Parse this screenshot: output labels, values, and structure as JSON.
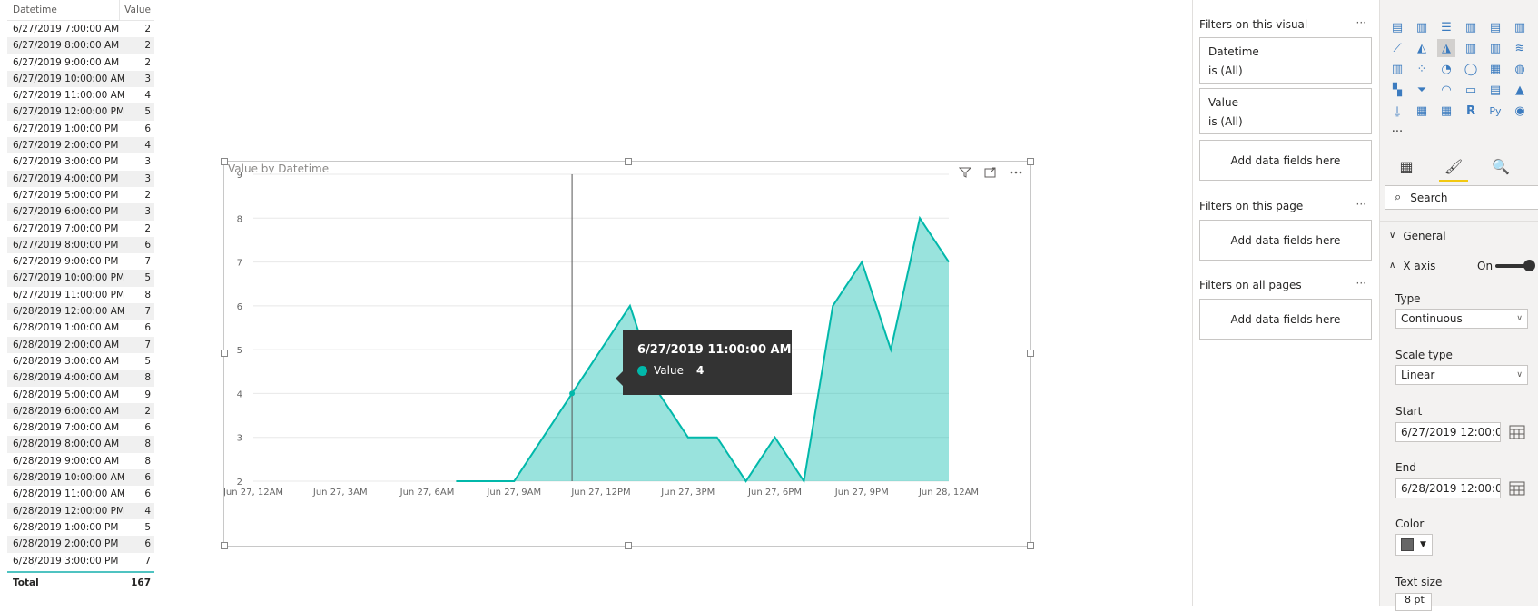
{
  "table": {
    "headers": [
      "Datetime",
      "Value"
    ],
    "rows": [
      [
        "6/27/2019 7:00:00 AM",
        "2"
      ],
      [
        "6/27/2019 8:00:00 AM",
        "2"
      ],
      [
        "6/27/2019 9:00:00 AM",
        "2"
      ],
      [
        "6/27/2019 10:00:00 AM",
        "3"
      ],
      [
        "6/27/2019 11:00:00 AM",
        "4"
      ],
      [
        "6/27/2019 12:00:00 PM",
        "5"
      ],
      [
        "6/27/2019 1:00:00 PM",
        "6"
      ],
      [
        "6/27/2019 2:00:00 PM",
        "4"
      ],
      [
        "6/27/2019 3:00:00 PM",
        "3"
      ],
      [
        "6/27/2019 4:00:00 PM",
        "3"
      ],
      [
        "6/27/2019 5:00:00 PM",
        "2"
      ],
      [
        "6/27/2019 6:00:00 PM",
        "3"
      ],
      [
        "6/27/2019 7:00:00 PM",
        "2"
      ],
      [
        "6/27/2019 8:00:00 PM",
        "6"
      ],
      [
        "6/27/2019 9:00:00 PM",
        "7"
      ],
      [
        "6/27/2019 10:00:00 PM",
        "5"
      ],
      [
        "6/27/2019 11:00:00 PM",
        "8"
      ],
      [
        "6/28/2019 12:00:00 AM",
        "7"
      ],
      [
        "6/28/2019 1:00:00 AM",
        "6"
      ],
      [
        "6/28/2019 2:00:00 AM",
        "7"
      ],
      [
        "6/28/2019 3:00:00 AM",
        "5"
      ],
      [
        "6/28/2019 4:00:00 AM",
        "8"
      ],
      [
        "6/28/2019 5:00:00 AM",
        "9"
      ],
      [
        "6/28/2019 6:00:00 AM",
        "2"
      ],
      [
        "6/28/2019 7:00:00 AM",
        "6"
      ],
      [
        "6/28/2019 8:00:00 AM",
        "8"
      ],
      [
        "6/28/2019 9:00:00 AM",
        "8"
      ],
      [
        "6/28/2019 10:00:00 AM",
        "6"
      ],
      [
        "6/28/2019 11:00:00 AM",
        "6"
      ],
      [
        "6/28/2019 12:00:00 PM",
        "4"
      ],
      [
        "6/28/2019 1:00:00 PM",
        "5"
      ],
      [
        "6/28/2019 2:00:00 PM",
        "6"
      ],
      [
        "6/28/2019 3:00:00 PM",
        "7"
      ]
    ],
    "total_label": "Total",
    "total_value": "167"
  },
  "visual": {
    "title": "Value by Datetime",
    "icons": [
      "filter-icon",
      "focus-mode-icon",
      "more-options-icon"
    ]
  },
  "chart_data": {
    "type": "area",
    "title": "Value by Datetime",
    "x_tick_labels": [
      "Jun 27, 12AM",
      "Jun 27, 3AM",
      "Jun 27, 6AM",
      "Jun 27, 9AM",
      "Jun 27, 12PM",
      "Jun 27, 3PM",
      "Jun 27, 6PM",
      "Jun 27, 9PM",
      "Jun 28, 12AM"
    ],
    "y_tick_labels": [
      "2",
      "3",
      "4",
      "5",
      "6",
      "7",
      "8",
      "9"
    ],
    "ylim": [
      2,
      9
    ],
    "grid": true,
    "color": "#01b8aa",
    "series": [
      {
        "name": "Value",
        "x": [
          "6/27/2019 7:00:00 AM",
          "6/27/2019 8:00:00 AM",
          "6/27/2019 9:00:00 AM",
          "6/27/2019 10:00:00 AM",
          "6/27/2019 11:00:00 AM",
          "6/27/2019 12:00:00 PM",
          "6/27/2019 1:00:00 PM",
          "6/27/2019 2:00:00 PM",
          "6/27/2019 3:00:00 PM",
          "6/27/2019 4:00:00 PM",
          "6/27/2019 5:00:00 PM",
          "6/27/2019 6:00:00 PM",
          "6/27/2019 7:00:00 PM",
          "6/27/2019 8:00:00 PM",
          "6/27/2019 9:00:00 PM",
          "6/27/2019 10:00:00 PM",
          "6/27/2019 11:00:00 PM",
          "6/28/2019 12:00:00 AM"
        ],
        "values": [
          2,
          2,
          2,
          3,
          4,
          5,
          6,
          4,
          3,
          3,
          2,
          3,
          2,
          6,
          7,
          5,
          8,
          7
        ]
      }
    ],
    "hover": {
      "x": "6/27/2019 11:00:00 AM",
      "value": "4"
    }
  },
  "tooltip": {
    "title": "6/27/2019 11:00:00 AM",
    "label": "Value",
    "value": "4"
  },
  "filters": {
    "on_visual": "Filters on this visual",
    "cards": [
      {
        "field": "Datetime",
        "state": "is (All)"
      },
      {
        "field": "Value",
        "state": "is (All)"
      }
    ],
    "add_label": "Add data fields here",
    "on_page": "Filters on this page",
    "on_all": "Filters on all pages",
    "more": "···"
  },
  "viz_pane": {
    "more": "···",
    "search_placeholder": "Search",
    "general": "General",
    "x_axis": "X axis",
    "x_axis_toggle": "On",
    "type_label": "Type",
    "type_value": "Continuous",
    "scale_label": "Scale type",
    "scale_value": "Linear",
    "start_label": "Start",
    "start_value": "6/27/2019 12:00:0...",
    "end_label": "End",
    "end_value": "6/28/2019 12:00:0...",
    "color_label": "Color",
    "color_value": "#666666",
    "textsize_label": "Text size",
    "textsize_value": "8",
    "textsize_unit": "pt"
  }
}
